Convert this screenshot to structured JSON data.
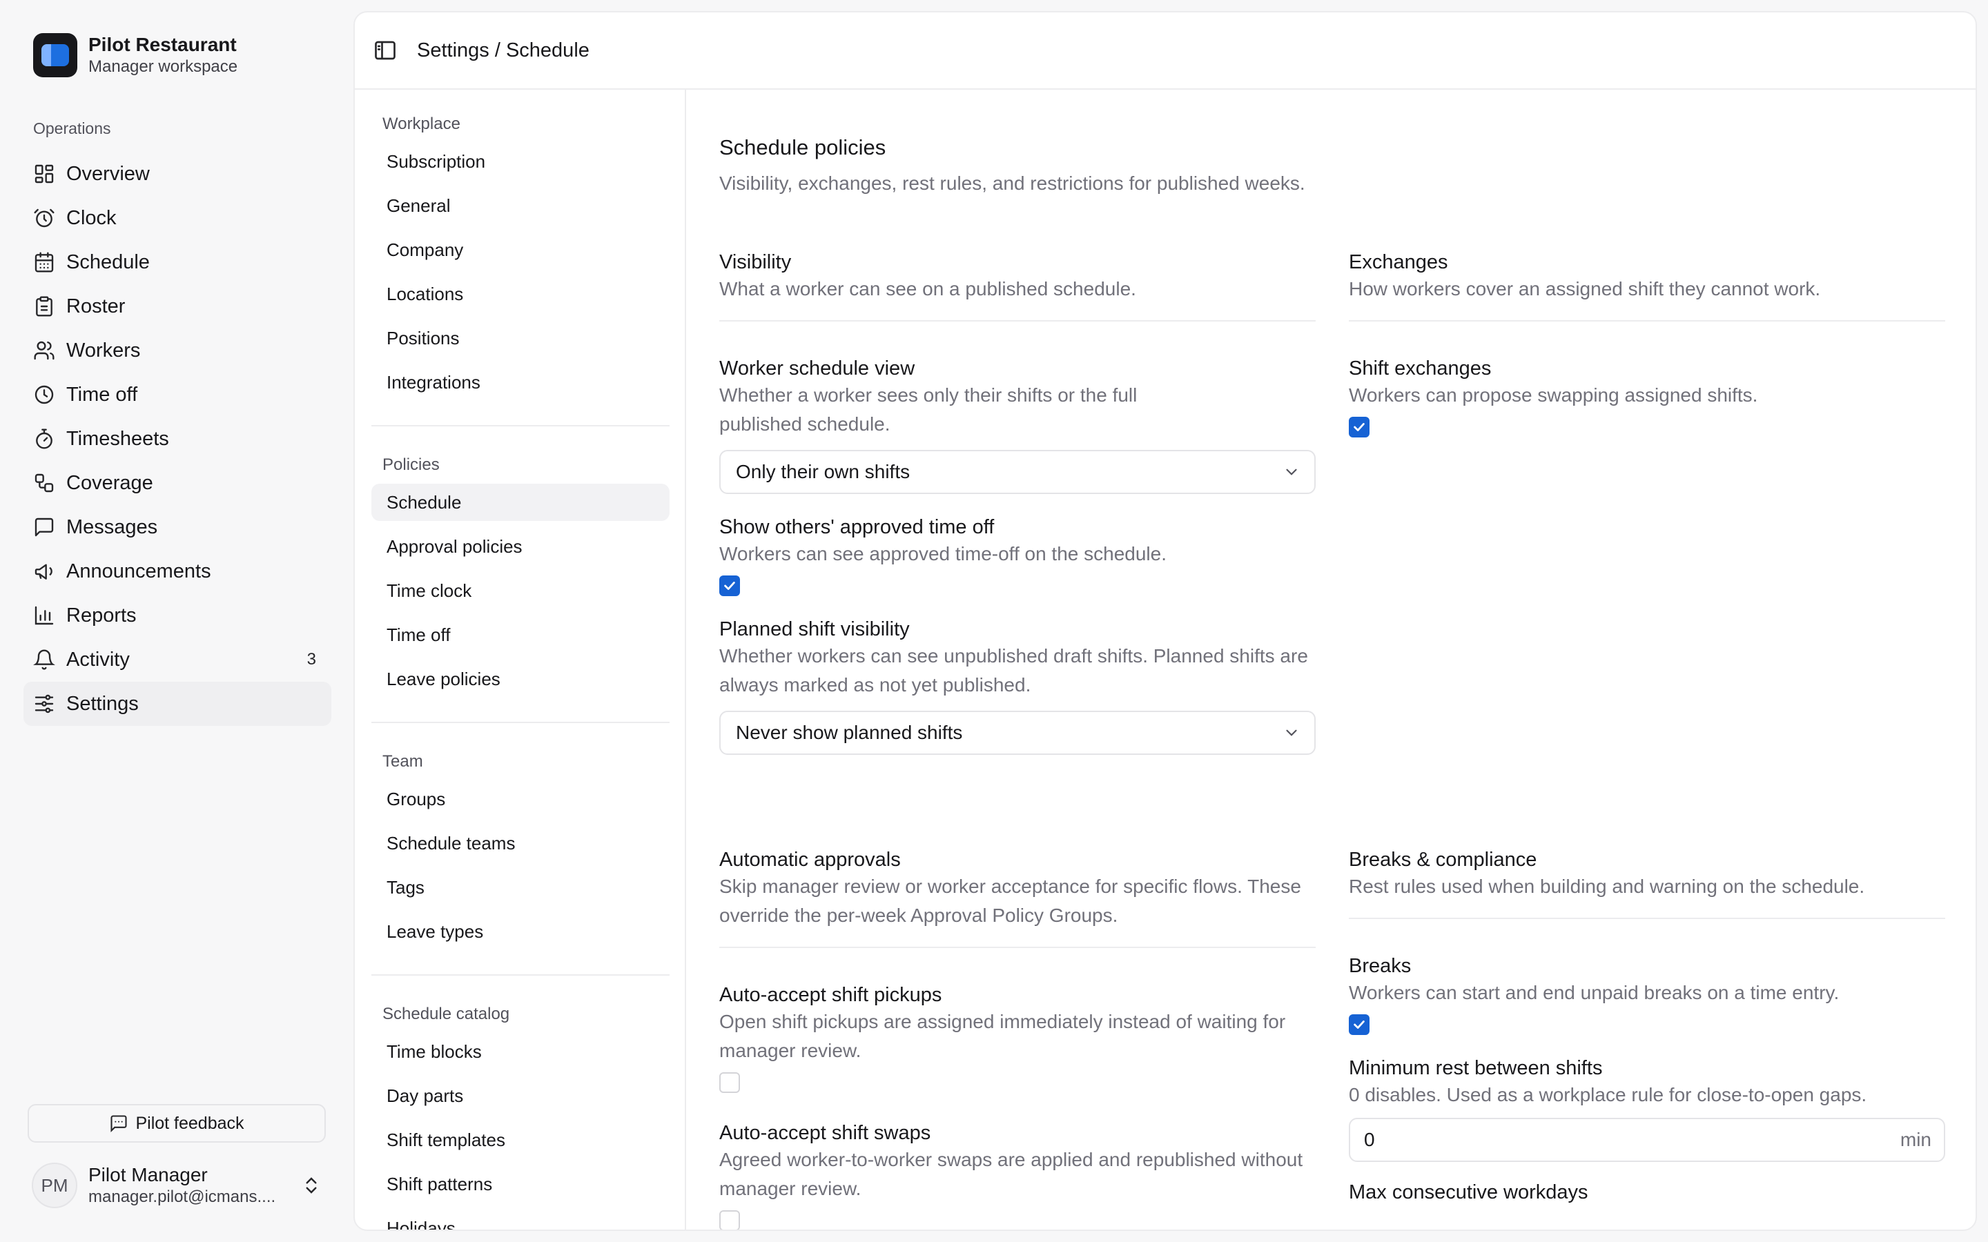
{
  "app": {
    "name": "Pilot Restaurant",
    "workspace": "Manager workspace"
  },
  "sidebar": {
    "section_label": "Operations",
    "items": [
      {
        "label": "Overview",
        "icon": "grid-icon"
      },
      {
        "label": "Clock",
        "icon": "alarm-clock-icon"
      },
      {
        "label": "Schedule",
        "icon": "calendar-icon"
      },
      {
        "label": "Roster",
        "icon": "clipboard-icon"
      },
      {
        "label": "Workers",
        "icon": "users-icon"
      },
      {
        "label": "Time off",
        "icon": "clock-icon"
      },
      {
        "label": "Timesheets",
        "icon": "stopwatch-icon"
      },
      {
        "label": "Coverage",
        "icon": "workflow-icon"
      },
      {
        "label": "Messages",
        "icon": "message-icon"
      },
      {
        "label": "Announcements",
        "icon": "megaphone-icon"
      },
      {
        "label": "Reports",
        "icon": "bar-chart-icon"
      },
      {
        "label": "Activity",
        "icon": "bell-icon",
        "count": "3"
      },
      {
        "label": "Settings",
        "icon": "sliders-icon",
        "active": true
      }
    ],
    "feedback_label": "Pilot feedback",
    "user": {
      "initials": "PM",
      "name": "Pilot Manager",
      "email": "manager.pilot@icmans...."
    }
  },
  "header": {
    "breadcrumb": "Settings / Schedule"
  },
  "subnav": {
    "groups": [
      {
        "label": "Workplace",
        "items": [
          "Subscription",
          "General",
          "Company",
          "Locations",
          "Positions",
          "Integrations"
        ]
      },
      {
        "label": "Policies",
        "items": [
          "Schedule",
          "Approval policies",
          "Time clock",
          "Time off",
          "Leave policies"
        ],
        "active": "Schedule"
      },
      {
        "label": "Team",
        "items": [
          "Groups",
          "Schedule teams",
          "Tags",
          "Leave types"
        ]
      },
      {
        "label": "Schedule catalog",
        "items": [
          "Time blocks",
          "Day parts",
          "Shift templates",
          "Shift patterns",
          "Holidays"
        ]
      }
    ]
  },
  "page": {
    "title": "Schedule policies",
    "description": "Visibility, exchanges, rest rules, and restrictions for published weeks."
  },
  "visibility": {
    "title": "Visibility",
    "description": "What a worker can see on a published schedule.",
    "schedule_view": {
      "label": "Worker schedule view",
      "description": "Whether a worker sees only their shifts or the full published schedule.",
      "value": "Only their own shifts"
    },
    "others_time_off": {
      "label": "Show others' approved time off",
      "description": "Workers can see approved time-off on the schedule.",
      "checked": true
    },
    "planned_shift": {
      "label": "Planned shift visibility",
      "description": "Whether workers can see unpublished draft shifts. Planned shifts are always marked as not yet published.",
      "value": "Never show planned shifts"
    }
  },
  "exchanges": {
    "title": "Exchanges",
    "description": "How workers cover an assigned shift they cannot work.",
    "shift_exchanges": {
      "label": "Shift exchanges",
      "description": "Workers can propose swapping assigned shifts.",
      "checked": true
    }
  },
  "auto_approvals": {
    "title": "Automatic approvals",
    "description": "Skip manager review or worker acceptance for specific flows. These override the per-week Approval Policy Groups.",
    "pickups": {
      "label": "Auto-accept shift pickups",
      "description": "Open shift pickups are assigned immediately instead of waiting for manager review.",
      "checked": false
    },
    "swaps": {
      "label": "Auto-accept shift swaps",
      "description": "Agreed worker-to-worker swaps are applied and republished without manager review.",
      "checked": false
    }
  },
  "breaks": {
    "title": "Breaks & compliance",
    "description": "Rest rules used when building and warning on the schedule.",
    "breaks_toggle": {
      "label": "Breaks",
      "description": "Workers can start and end unpaid breaks on a time entry.",
      "checked": true
    },
    "min_rest": {
      "label": "Minimum rest between shifts",
      "description": "0 disables. Used as a workplace rule for close-to-open gaps.",
      "value": "0",
      "unit": "min"
    },
    "max_consecutive": {
      "label": "Max consecutive workdays"
    }
  },
  "colors": {
    "accent": "#1662d4",
    "active_bg": "#efeff1",
    "muted_text": "#71717a"
  }
}
